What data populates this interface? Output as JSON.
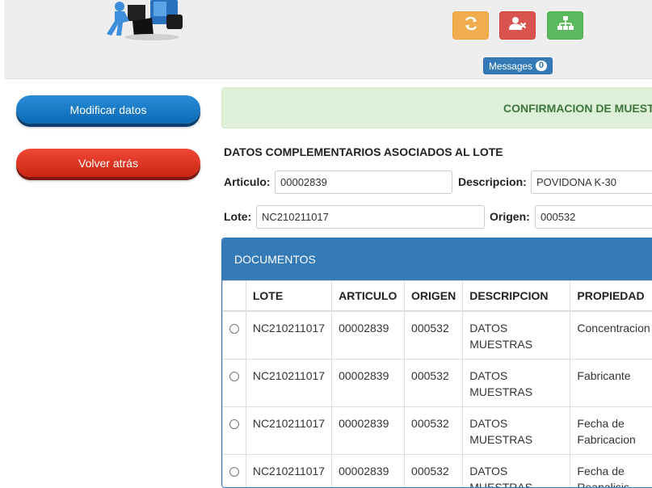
{
  "header": {
    "messages_label": "Messages",
    "messages_count": "0",
    "buttons": {
      "refresh_icon": "refresh-icon",
      "user_remove_icon": "user-remove-icon",
      "sitemap_icon": "sitemap-icon"
    },
    "colors": {
      "refresh": "#f0ad4e",
      "user_remove": "#d9534f",
      "sitemap": "#5cb85c"
    }
  },
  "sidebar": {
    "modify_label": "Modificar datos",
    "back_label": "Volver atrás"
  },
  "alert": {
    "text": "CONFIRMACION DE MUEST"
  },
  "form": {
    "section_title": "DATOS COMPLEMENTARIOS ASOCIADOS AL LOTE",
    "articulo_label": "Articulo:",
    "articulo_value": "00002839",
    "descripcion_label": "Descripcion:",
    "descripcion_value": "POVIDONA K-30",
    "lote_label": "Lote:",
    "lote_value": "NC210211017",
    "origen_label": "Origen:",
    "origen_value": "000532"
  },
  "documents": {
    "title": "DOCUMENTOS",
    "columns": [
      "LOTE",
      "ARTICULO",
      "ORIGEN",
      "DESCRIPCION",
      "PROPIEDAD"
    ],
    "rows": [
      {
        "lote": "NC210211017",
        "articulo": "00002839",
        "origen": "000532",
        "descripcion": "DATOS MUESTRAS",
        "propiedad": "Concentracion"
      },
      {
        "lote": "NC210211017",
        "articulo": "00002839",
        "origen": "000532",
        "descripcion": "DATOS MUESTRAS",
        "propiedad": "Fabricante"
      },
      {
        "lote": "NC210211017",
        "articulo": "00002839",
        "origen": "000532",
        "descripcion": "DATOS MUESTRAS",
        "propiedad": "Fecha de Fabricacion"
      },
      {
        "lote": "NC210211017",
        "articulo": "00002839",
        "origen": "000532",
        "descripcion": "DATOS MUESTRAS",
        "propiedad": "Fecha de Reanalisis"
      }
    ]
  }
}
